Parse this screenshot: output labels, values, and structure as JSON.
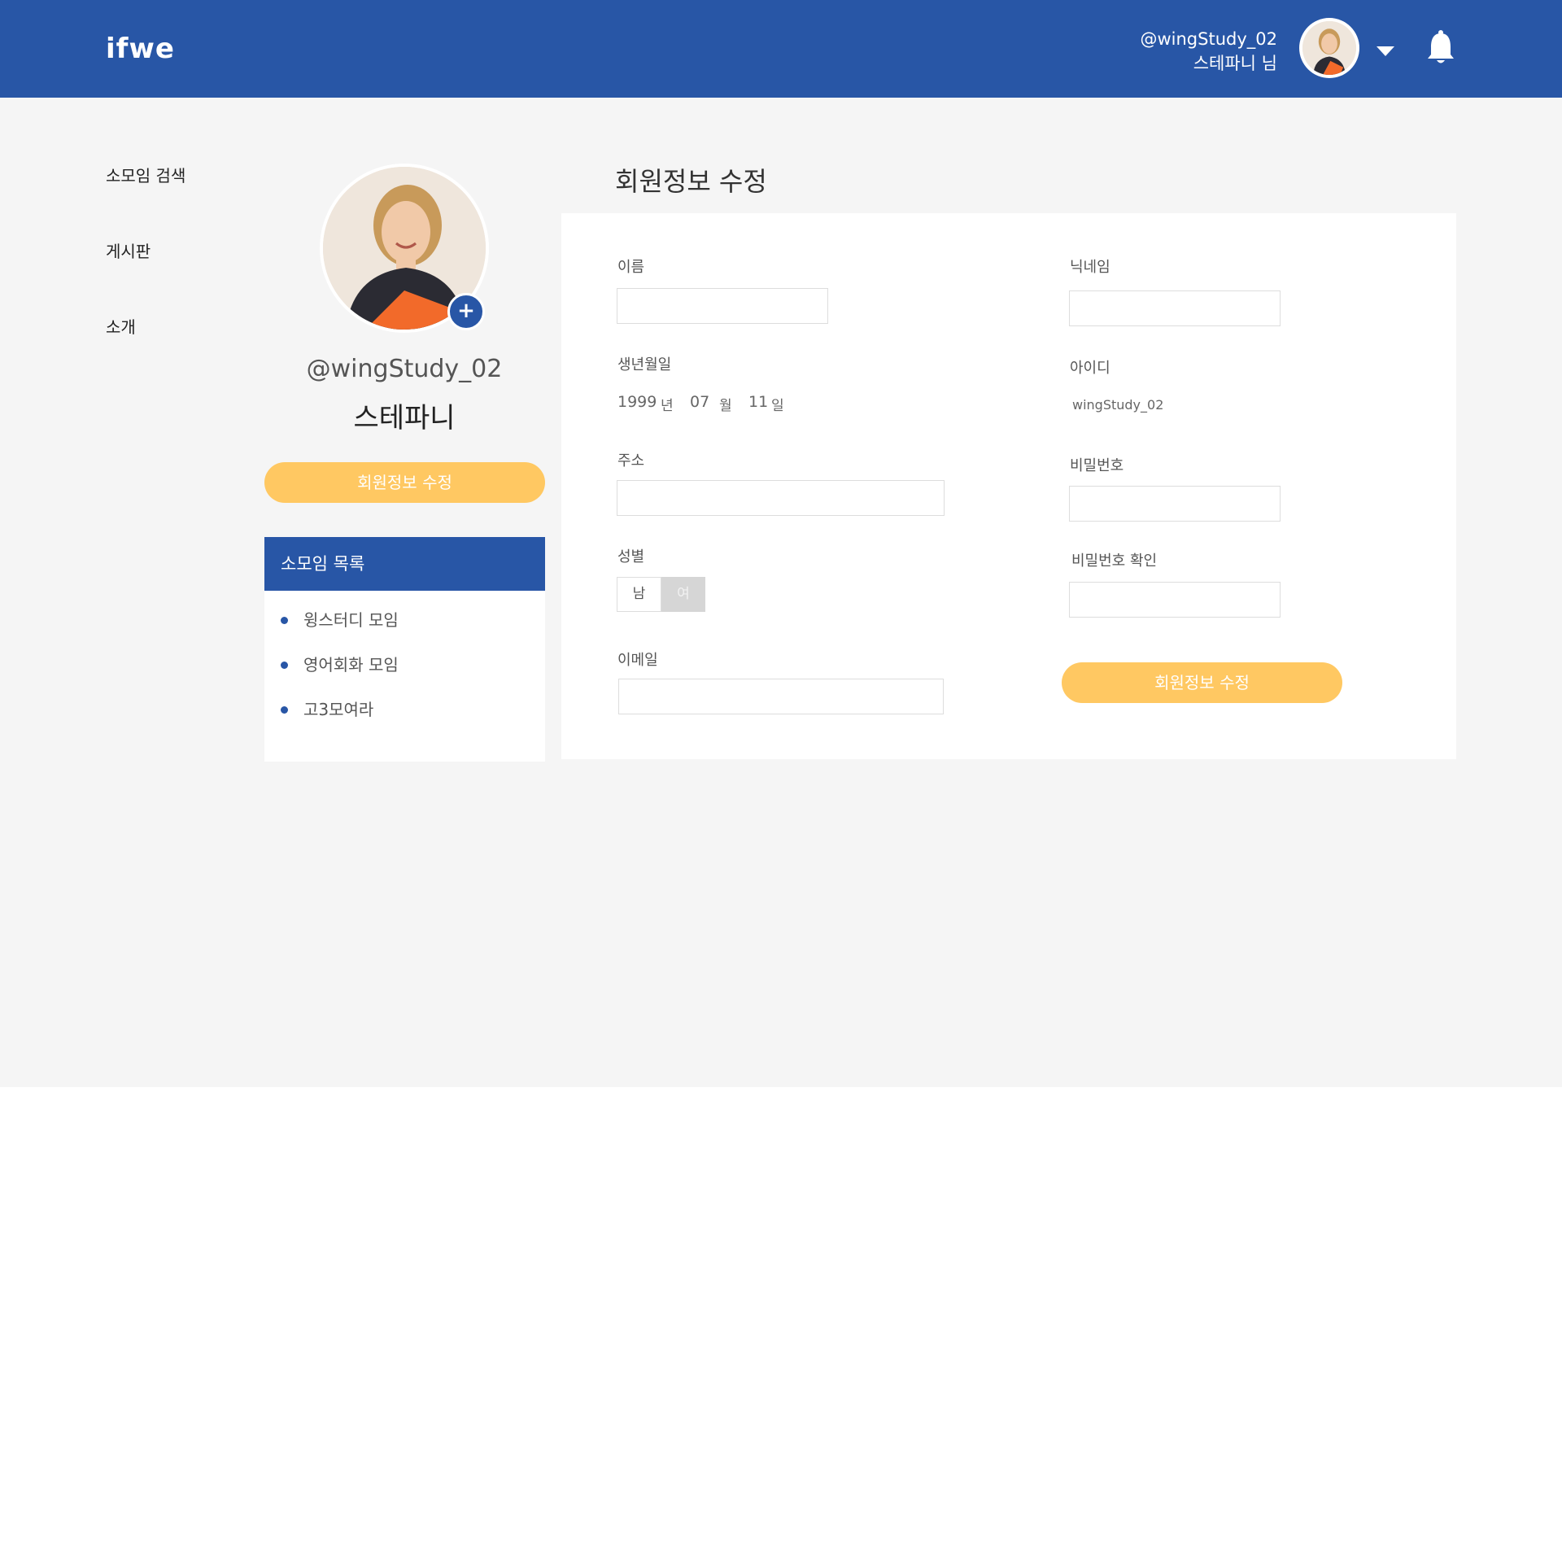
{
  "header": {
    "logo": "ifwe",
    "user_handle": "@wingStudy_02",
    "user_name": "스테파니 님"
  },
  "sidebar": {
    "items": [
      {
        "label": "소모임 검색"
      },
      {
        "label": "게시판"
      },
      {
        "label": "소개"
      }
    ]
  },
  "profile": {
    "handle": "@wingStudy_02",
    "name": "스테파니",
    "add_photo_label": "+",
    "edit_button": "회원정보 수정"
  },
  "groups": {
    "title": "소모임 목록",
    "items": [
      {
        "label": "윙스터디 모임"
      },
      {
        "label": "영어회화 모임"
      },
      {
        "label": "고3모여라"
      }
    ]
  },
  "form": {
    "page_title": "회원정보 수정",
    "name_label": "이름",
    "name_value": "",
    "birth_label": "생년월일",
    "birth_year": "1999",
    "birth_year_unit": "년",
    "birth_month": "07",
    "birth_month_unit": "월",
    "birth_day": "11",
    "birth_day_unit": "일",
    "address_label": "주소",
    "address_value": "",
    "gender_label": "성별",
    "gender_male": "남",
    "gender_female": "여",
    "gender_selected": "여",
    "email_label": "이메일",
    "email_value": "",
    "nickname_label": "닉네임",
    "nickname_value": "",
    "id_label": "아이디",
    "id_value": "wingStudy_02",
    "password_label": "비밀번호",
    "password_confirm_label": "비밀번호 확인",
    "submit_button": "회원정보 수정"
  },
  "colors": {
    "brand_blue": "#2856a6",
    "accent_yellow": "#ffc862",
    "background": "#f5f5f5"
  }
}
